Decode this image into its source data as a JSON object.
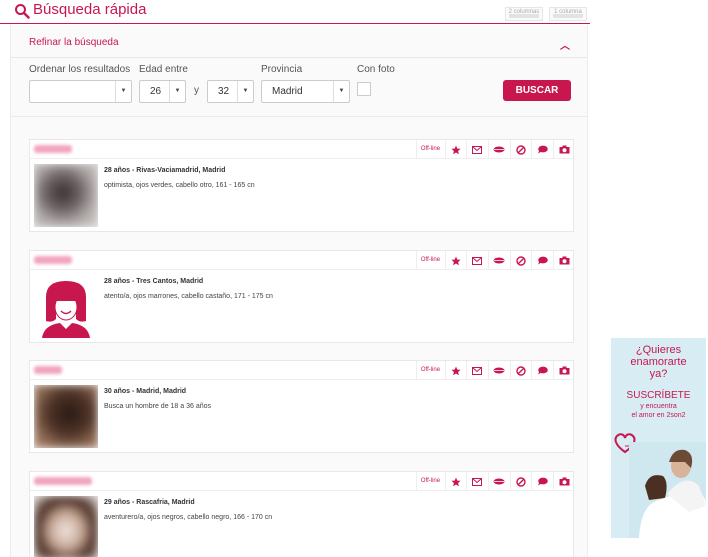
{
  "header": {
    "title": "Búsqueda rápida",
    "col2_label": "2 columnas",
    "col1_label": "1 columna"
  },
  "filter": {
    "title": "Refinar la búsqueda",
    "order_label": "Ordenar los resultados",
    "order_value": "",
    "age_label": "Edad entre",
    "age_min": "26",
    "age_and": "y",
    "age_max": "32",
    "province_label": "Provincia",
    "province_value": "Madrid",
    "photo_label": "Con foto",
    "button": "BUSCAR"
  },
  "profiles": [
    {
      "status": "Off-line",
      "line1": "28 años - Rivas-Vaciamadrid, Madrid",
      "line2": "optimista, ojos verdes, cabello otro, 161 - 165 cn"
    },
    {
      "status": "Off-line",
      "line1": "28 años - Tres Cantos, Madrid",
      "line2": "atento/a, ojos marrones, cabello castaño, 171 - 175 cn"
    },
    {
      "status": "Off-line",
      "line1": "30 años - Madrid, Madrid",
      "line2": "Busca un hombre de 18 a 36 años"
    },
    {
      "status": "Off-line",
      "line1": "29 años - Rascafria, Madrid",
      "line2": "aventurero/a, ojos negros, cabello negro, 166 - 170 cn"
    }
  ],
  "ad": {
    "line1a": "¿Quieres",
    "line1b": "enamorarte",
    "line1c": "ya?",
    "line2": "SUSCRÍBETE",
    "line3a": "y encuentra",
    "line3b": "el amor en 2son2"
  },
  "colors": {
    "accent": "#c8174f"
  },
  "icons": [
    "search-icon",
    "chevron-up-icon",
    "star-icon",
    "mail-icon",
    "kiss-icon",
    "block-icon",
    "chat-icon",
    "camera-icon",
    "heart-icon"
  ]
}
